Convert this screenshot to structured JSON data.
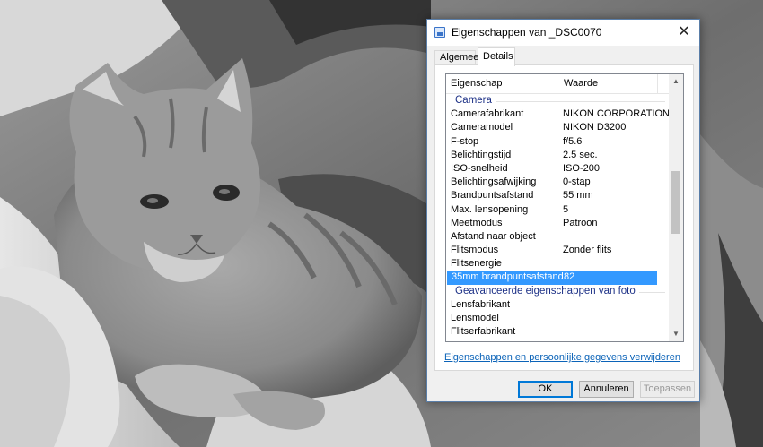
{
  "dialog": {
    "title": "Eigenschappen van _DSC0070",
    "tabs": [
      {
        "label": "Algemeen",
        "active": false
      },
      {
        "label": "Details",
        "active": true
      }
    ],
    "columns": {
      "property": "Eigenschap",
      "value": "Waarde"
    },
    "groups": {
      "camera": "Camera",
      "advanced": "Geavanceerde eigenschappen van foto"
    },
    "camera_rows": [
      {
        "property": "Camerafabrikant",
        "value": "NIKON CORPORATION"
      },
      {
        "property": "Cameramodel",
        "value": "NIKON D3200"
      },
      {
        "property": "F-stop",
        "value": "f/5.6"
      },
      {
        "property": "Belichtingstijd",
        "value": "2.5 sec."
      },
      {
        "property": "ISO-snelheid",
        "value": "ISO-200"
      },
      {
        "property": "Belichtingsafwijking",
        "value": "0-stap"
      },
      {
        "property": "Brandpuntsafstand",
        "value": "55 mm"
      },
      {
        "property": "Max. lensopening",
        "value": "5"
      },
      {
        "property": "Meetmodus",
        "value": "Patroon"
      },
      {
        "property": "Afstand naar object",
        "value": ""
      },
      {
        "property": "Flitsmodus",
        "value": "Zonder flits"
      },
      {
        "property": "Flitsenergie",
        "value": ""
      },
      {
        "property": "35mm brandpuntsafstand",
        "value": "82"
      }
    ],
    "advanced_rows": [
      {
        "property": "Lensfabrikant",
        "value": ""
      },
      {
        "property": "Lensmodel",
        "value": ""
      },
      {
        "property": "Flitserfabrikant",
        "value": ""
      }
    ],
    "remove_link": "Eigenschappen en persoonlijke gegevens verwijderen",
    "buttons": {
      "ok": "OK",
      "cancel": "Annuleren",
      "apply": "Toepassen"
    },
    "close_glyph": "✕",
    "scroll_up_glyph": "▲",
    "scroll_down_glyph": "▼",
    "colors": {
      "selection": "#3399ff",
      "link": "#0b63b8",
      "group_header": "#1e3287",
      "ok_border": "#0078d7"
    }
  }
}
